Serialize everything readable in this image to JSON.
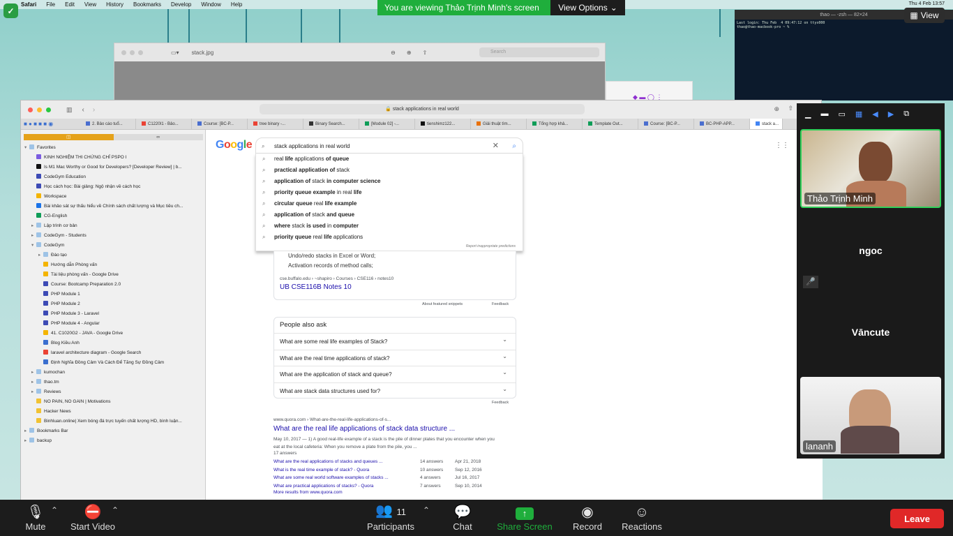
{
  "menubar": {
    "app": "Safari",
    "items": [
      "File",
      "Edit",
      "View",
      "History",
      "Bookmarks",
      "Develop",
      "Window",
      "Help"
    ],
    "clock": "Thu 4 Feb 13:57"
  },
  "zoom_banner": {
    "message": "You are viewing Thảo Trịnh Minh's screen",
    "options": "View Options"
  },
  "view_button": "View",
  "terminal": {
    "title": "thao — -zsh — 82×24",
    "lines": [
      "Last login: Thu Feb  4 09:47:12 on ttys000",
      "thao@thao-macbook-pro ~ % "
    ]
  },
  "preview": {
    "title": "stack.jpg",
    "search_placeholder": "Search"
  },
  "safari": {
    "url": "stack applications in real world",
    "tabs": [
      "2. Bảo cáo tuổ...",
      "C1220I1 - Bảo...",
      "Course: [BC-P...",
      "tree binary -...",
      "Binary Search...",
      "[Module 02] -...",
      "tienshimz122...",
      "Giải thuật tìm...",
      "Tổng hợp khả...",
      "Template Out...",
      "Course: [BC-P...",
      "BC-PHP-APP...",
      "stack a..."
    ],
    "bookmarks": [
      {
        "label": "Favorites",
        "level": 0,
        "kind": "folder-open"
      },
      {
        "label": "KINH NGHIỆM THI CHỨNG CHỈ PSPO I",
        "level": 1,
        "kind": "v"
      },
      {
        "label": "Is M1 Mac Worthy or Good for Developers? [Developer Review] | b...",
        "level": 1,
        "kind": "dark"
      },
      {
        "label": "CodeGym Education",
        "level": 1,
        "kind": "cg"
      },
      {
        "label": "Học cách học: Bài giảng: Ngộ nhận về cách học",
        "level": 1,
        "kind": "cg"
      },
      {
        "label": "Workspace",
        "level": 1,
        "kind": "drive"
      },
      {
        "label": "Bài khảo sát sự thấu hiểu về Chính sách chất lượng và Mục tiêu ch...",
        "level": 1,
        "kind": "doc"
      },
      {
        "label": "CG-English",
        "level": 1,
        "kind": "green"
      },
      {
        "label": "Lập trình cơ bản",
        "level": 1,
        "kind": "folder"
      },
      {
        "label": "CodeGym - Students",
        "level": 1,
        "kind": "folder"
      },
      {
        "label": "CodeGym",
        "level": 1,
        "kind": "folder-open"
      },
      {
        "label": "Đào tạo",
        "level": 2,
        "kind": "folder"
      },
      {
        "label": "Hướng dẫn Phòng vấn",
        "level": 2,
        "kind": "drive"
      },
      {
        "label": "Tài liệu phòng vấn - Google Drive",
        "level": 2,
        "kind": "drive"
      },
      {
        "label": "Course: Bootcamp Preparation 2.0",
        "level": 2,
        "kind": "cg"
      },
      {
        "label": "PHP Module 1",
        "level": 2,
        "kind": "cg"
      },
      {
        "label": "PHP Module 2",
        "level": 2,
        "kind": "cg"
      },
      {
        "label": "PHP Module 3 - Laravel",
        "level": 2,
        "kind": "cg"
      },
      {
        "label": "PHP Module 4 - Angular",
        "level": 2,
        "kind": "cg"
      },
      {
        "label": "41. C1020G2 - JAVA - Google Drive",
        "level": 2,
        "kind": "drive"
      },
      {
        "label": "Blog Kiều Anh",
        "level": 2,
        "kind": "blue"
      },
      {
        "label": "laravel architecture diagram - Google Search",
        "level": 2,
        "kind": "google"
      },
      {
        "label": "Định Nghĩa Đồng Cảm Và Cách Để Tăng Sự Đồng Cảm",
        "level": 2,
        "kind": "blue"
      },
      {
        "label": "kumochan",
        "level": 1,
        "kind": "folder"
      },
      {
        "label": "thao.tm",
        "level": 1,
        "kind": "folder"
      },
      {
        "label": "Reviews",
        "level": 1,
        "kind": "folder"
      },
      {
        "label": "NO PAIN, NO GAIN | Motivations",
        "level": 1,
        "kind": "yellow"
      },
      {
        "label": "Hacker News",
        "level": 1,
        "kind": "yellow"
      },
      {
        "label": "Binhluan.online| Xem bóng đá trực tuyến chất lượng HD, bình luận...",
        "level": 1,
        "kind": "yellow"
      },
      {
        "label": "Bookmarks Bar",
        "level": 0,
        "kind": "folder"
      },
      {
        "label": "backup",
        "level": 0,
        "kind": "folder"
      }
    ]
  },
  "google": {
    "logo": "Google",
    "query": "stack applications in real world",
    "suggestions": [
      [
        [
          "real ",
          false
        ],
        [
          "life",
          true
        ],
        [
          " applications ",
          false
        ],
        [
          "of queue",
          true
        ]
      ],
      [
        [
          "practical application of",
          true
        ],
        [
          " stack",
          false
        ]
      ],
      [
        [
          "application of",
          true
        ],
        [
          " stack ",
          false
        ],
        [
          "in computer science",
          true
        ]
      ],
      [
        [
          "priority queue example",
          true
        ],
        [
          " in ",
          false
        ],
        [
          "real",
          false
        ],
        [
          " life",
          true
        ]
      ],
      [
        [
          "circular queue",
          true
        ],
        [
          " real ",
          false
        ],
        [
          "life example",
          true
        ]
      ],
      [
        [
          "application of",
          true
        ],
        [
          " stack ",
          false
        ],
        [
          "and queue",
          true
        ]
      ],
      [
        [
          "where",
          true
        ],
        [
          " stack ",
          false
        ],
        [
          "is used",
          true
        ],
        [
          " in ",
          false
        ],
        [
          "computer",
          true
        ]
      ],
      [
        [
          "priority queue",
          true
        ],
        [
          " real ",
          false
        ],
        [
          "life",
          true
        ],
        [
          " applications",
          false
        ]
      ]
    ],
    "report": "Report inappropriate predictions",
    "snippet_bullets": [
      "Undo/redo stacks in Excel or Word;",
      "Activation records of method calls;"
    ],
    "snippet_source": "cse.buffalo.edu › ~shapiro › Courses › CSE116 › notes10",
    "snippet_title": "UB CSE116B Notes 10",
    "snippet_about": "About featured snippets",
    "snippet_feedback": "Feedback",
    "paa_title": "People also ask",
    "paa": [
      "What are some real life examples of Stack?",
      "What are the real time applications of stack?",
      "What are the application of stack and queue?",
      "What are stack data structures used for?"
    ],
    "paa_feedback": "Feedback",
    "quora_url": "www.quora.com › What-are-the-real-life-applications-of-s...",
    "quora_title": "What are the real life applications of stack data structure ...",
    "quora_date": "May 10, 2017 —",
    "quora_desc": "1) A good real-life example of a stack is the pile of dinner plates that you encounter when you eat at the local cafeteria: When you remove a plate from the pile, you ...",
    "quora_answers": "17 answers",
    "quora_rows": [
      {
        "q": "What are the real applications of stacks and queues ...",
        "a": "14 answers",
        "d": "Apr 21, 2018"
      },
      {
        "q": "What is the real time example of stack? - Quora",
        "a": "10 answers",
        "d": "Sep 12, 2016"
      },
      {
        "q": "What are some real world software examples of stacks ...",
        "a": "4 answers",
        "d": "Jul 16, 2017"
      },
      {
        "q": "What are practical applications of stacks? - Quora",
        "a": "7 answers",
        "d": "Sep 10, 2014"
      }
    ],
    "quora_more": "More results from www.quora.com"
  },
  "gallery": {
    "participants": [
      {
        "name": "Thảo Trịnh Minh",
        "video": true,
        "active": true
      },
      {
        "name": "ngoc",
        "video": false,
        "muted": true
      },
      {
        "name": "Vāncute",
        "video": false
      },
      {
        "name": "lananh",
        "video": true
      }
    ]
  },
  "toolbar": {
    "mute": "Mute",
    "start_video": "Start Video",
    "participants": "Participants",
    "participants_count": "11",
    "chat": "Chat",
    "share_screen": "Share Screen",
    "record": "Record",
    "reactions": "Reactions",
    "leave": "Leave"
  },
  "colors": {
    "zoom_green": "#1fae3c",
    "leave_red": "#e02828",
    "link_blue": "#1a0dab"
  }
}
